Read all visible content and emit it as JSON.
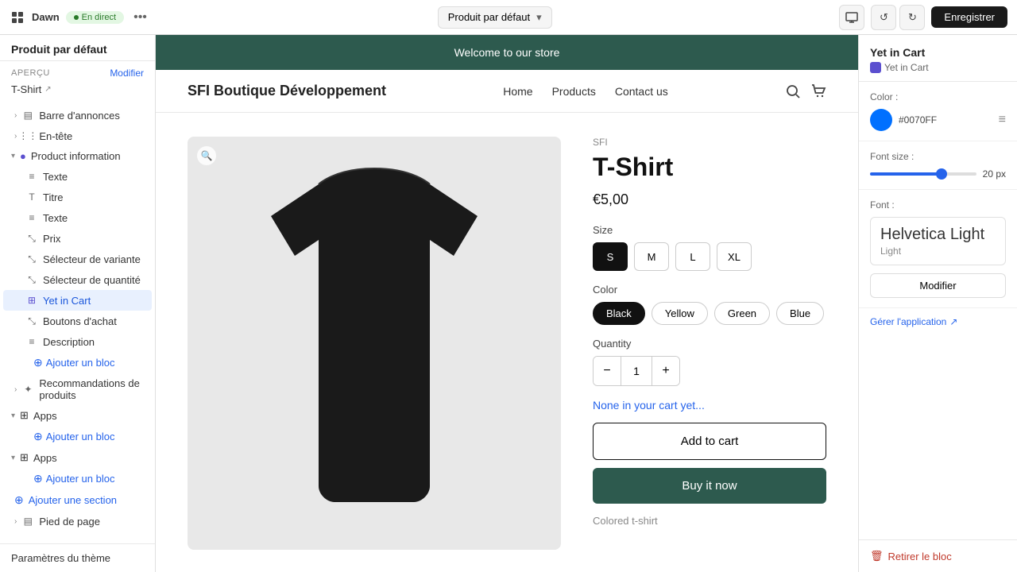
{
  "topbar": {
    "store_name": "Dawn",
    "status": "En direct",
    "dots": "•••",
    "theme_selector": "Produit par défaut",
    "save_label": "Enregistrer"
  },
  "sidebar": {
    "apercu_label": "APERÇU",
    "modifier_label": "Modifier",
    "tshirt_label": "T-Shirt",
    "sections": [
      {
        "label": "Barre d'annonces",
        "icon": "▤"
      },
      {
        "label": "En-tête",
        "icon": "⋮⋮"
      },
      {
        "label": "Product information",
        "icon": "◉",
        "active": true
      },
      {
        "label": "Texte",
        "icon": "≡",
        "indent": 1
      },
      {
        "label": "Titre",
        "icon": "T",
        "indent": 1
      },
      {
        "label": "Texte",
        "icon": "≡",
        "indent": 1
      },
      {
        "label": "Prix",
        "icon": "⤡",
        "indent": 1
      },
      {
        "label": "Sélecteur de variante",
        "icon": "⤡",
        "indent": 1
      },
      {
        "label": "Sélecteur de quantité",
        "icon": "⤡",
        "indent": 1
      },
      {
        "label": "Yet in Cart",
        "icon": "⤡",
        "indent": 1,
        "active": true
      },
      {
        "label": "Boutons d'achat",
        "icon": "⤡",
        "indent": 1
      },
      {
        "label": "Description",
        "icon": "≡",
        "indent": 1
      }
    ],
    "add_block_label": "Ajouter un bloc",
    "recommendations_label": "Recommandations de produits",
    "apps1_label": "Apps",
    "apps1_add": "Ajouter un bloc",
    "apps2_label": "Apps",
    "apps2_add": "Ajouter un bloc",
    "add_section_label": "Ajouter une section",
    "pied_label": "Pied de page",
    "settings_label": "Paramètres du thème"
  },
  "store": {
    "banner": "Welcome to our store",
    "logo": "SFI Boutique Développement",
    "nav_links": [
      "Home",
      "Products",
      "Contact us"
    ],
    "brand": "SFI",
    "product_title": "T-Shirt",
    "price": "€5,00",
    "size_label": "Size",
    "sizes": [
      "S",
      "M",
      "L",
      "XL"
    ],
    "active_size": "S",
    "color_label": "Color",
    "colors": [
      "Black",
      "Yellow",
      "Green",
      "Blue"
    ],
    "active_color": "Black",
    "quantity_label": "Quantity",
    "quantity_value": "1",
    "none_in_cart": "None in your cart yet...",
    "add_to_cart": "Add to cart",
    "buy_now": "Buy it now",
    "colored_tshirt": "Colored t-shirt"
  },
  "right_panel": {
    "title": "Yet in Cart",
    "subtitle": "Yet in Cart",
    "color_label": "Color :",
    "color_hex": "#0070FF",
    "color_display": "#0070FF",
    "font_size_label": "Font size :",
    "font_size_value": "20 px",
    "font_size_percent": 70,
    "font_label": "Font :",
    "font_name": "Helvetica Light",
    "font_style": "Light",
    "modifier_label": "Modifier",
    "app_link": "Gérer l'application",
    "remove_label": "Retirer le bloc"
  }
}
